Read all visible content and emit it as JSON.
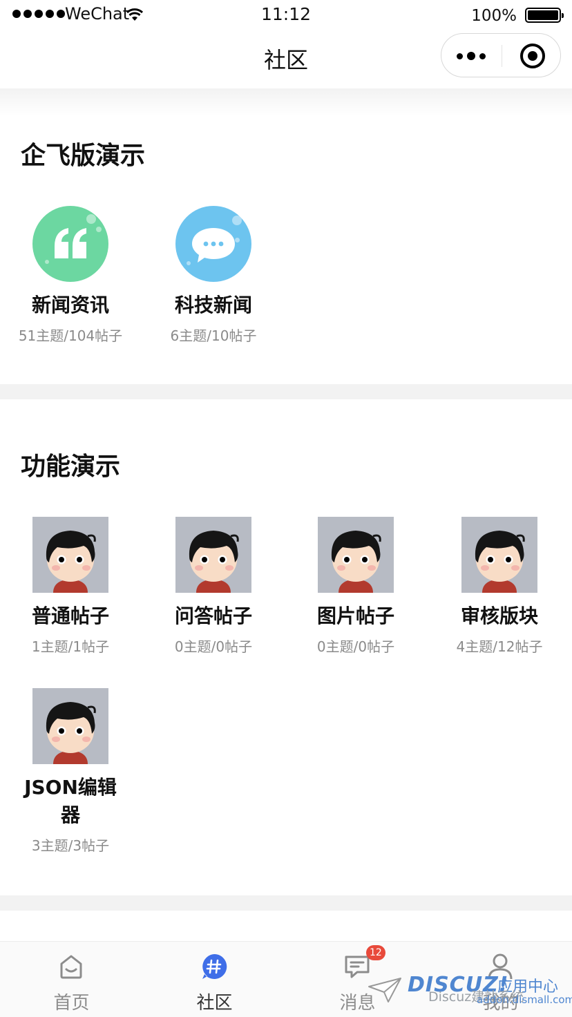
{
  "status_bar": {
    "carrier": "WeChat",
    "time": "11:12",
    "battery": "100%"
  },
  "nav": {
    "title": "社区"
  },
  "sections": [
    {
      "title": "企飞版演示",
      "forums": [
        {
          "name": "新闻资讯",
          "stats": "51主题/104帖子",
          "icon": "quote-icon",
          "color": "#6cd7a1"
        },
        {
          "name": "科技新闻",
          "stats": "6主题/10帖子",
          "icon": "chat-bubble-icon",
          "color": "#6dc4ef"
        }
      ]
    },
    {
      "title": "功能演示",
      "forums": [
        {
          "name": "普通帖子",
          "stats": "1主题/1帖子",
          "icon": "avatar-icon"
        },
        {
          "name": "问答帖子",
          "stats": "0主题/0帖子",
          "icon": "avatar-icon"
        },
        {
          "name": "图片帖子",
          "stats": "0主题/0帖子",
          "icon": "avatar-icon"
        },
        {
          "name": "审核版块",
          "stats": "4主题/12帖子",
          "icon": "avatar-icon"
        },
        {
          "name": "JSON编辑器",
          "stats": "3主题/3帖子",
          "icon": "avatar-icon"
        }
      ]
    }
  ],
  "tab_bar": {
    "tabs": [
      {
        "label": "首页",
        "icon": "home-icon",
        "active": false
      },
      {
        "label": "社区",
        "icon": "hash-icon",
        "active": true
      },
      {
        "label": "消息",
        "icon": "message-icon",
        "active": false,
        "badge": "12"
      },
      {
        "label": "我的",
        "icon": "user-icon",
        "active": false
      }
    ]
  },
  "watermark": {
    "logo": "DISCUZ!",
    "text_cn": "应用中心",
    "subtitle": "Discuz建站系统",
    "url": "addon.dismall.com"
  },
  "colors": {
    "active_tab": "#3f6ee8",
    "badge": "#e84a3b",
    "quote_icon_bg": "#6cd7a1",
    "chat_icon_bg": "#6dc4ef"
  }
}
